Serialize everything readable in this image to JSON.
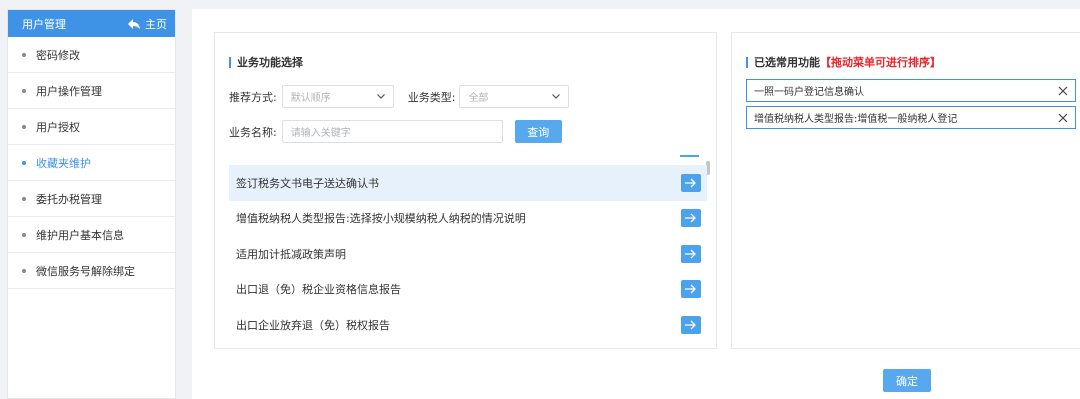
{
  "sidebar": {
    "title": "用户管理",
    "home_label": "主页",
    "items": [
      {
        "label": "密码修改"
      },
      {
        "label": "用户操作管理"
      },
      {
        "label": "用户授权"
      },
      {
        "label": "收藏夹维护"
      },
      {
        "label": "委托办税管理"
      },
      {
        "label": "维护用户基本信息"
      },
      {
        "label": "微信服务号解除绑定"
      }
    ],
    "active_index": 3
  },
  "left_panel": {
    "title": "业务功能选择",
    "sort_label": "推荐方式:",
    "sort_value": "默认顺序",
    "type_label": "业务类型:",
    "type_value": "全部",
    "name_label": "业务名称:",
    "name_placeholder": "请输入关键字",
    "query_button": "查询",
    "items": [
      {
        "label": "签订税务文书电子送达确认书"
      },
      {
        "label": "增值税纳税人类型报告:选择按小规模纳税人纳税的情况说明"
      },
      {
        "label": "适用加计抵减政策声明"
      },
      {
        "label": "出口退（免）税企业资格信息报告"
      },
      {
        "label": "出口企业放弃退（免）税权报告"
      }
    ]
  },
  "right_panel": {
    "title": "已选常用功能",
    "hint": "【拖动菜单可进行排序】",
    "chosen": [
      {
        "label": "一照一码户登记信息确认"
      },
      {
        "label": "增值税纳税人类型报告:增值税一般纳税人登记"
      }
    ]
  },
  "confirm_button": "确定",
  "colors": {
    "primary": "#3f93e6",
    "button": "#58a8ee",
    "hint_red": "#e8262b",
    "highlight_row": "#e6f1fb"
  }
}
